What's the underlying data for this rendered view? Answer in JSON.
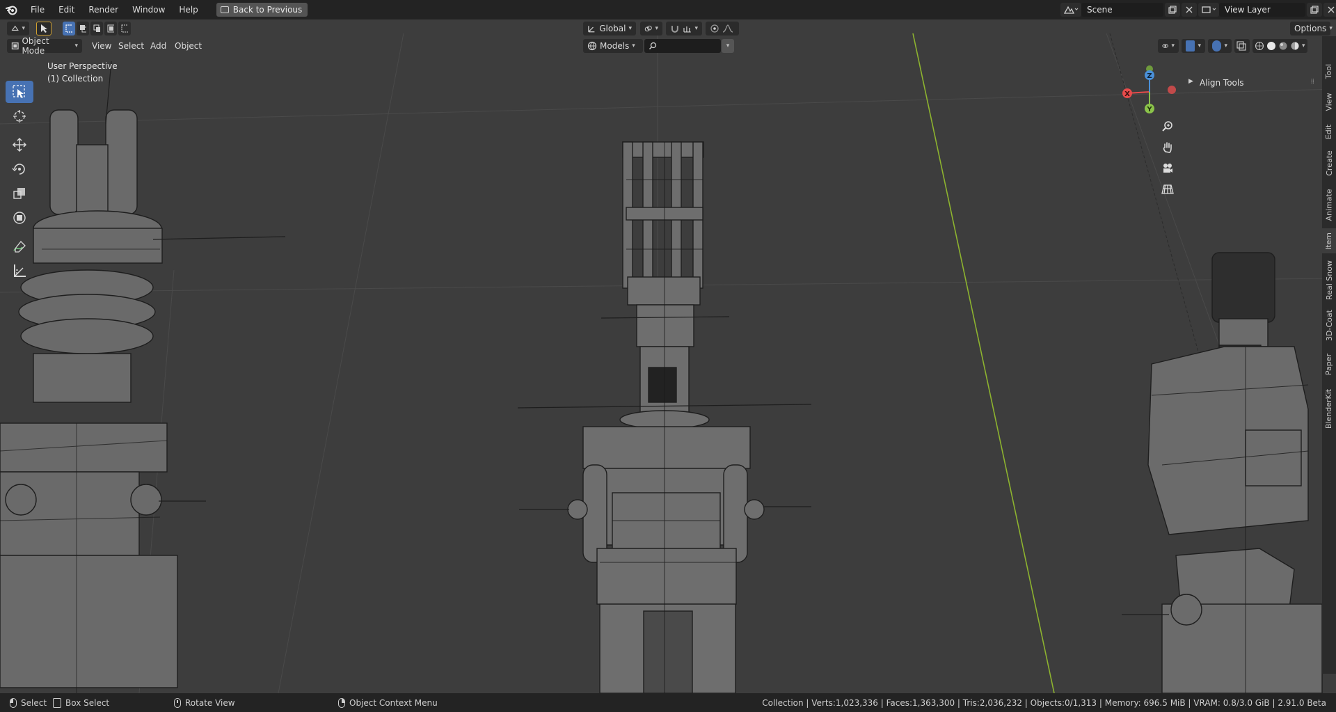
{
  "menubar": {
    "items": [
      "File",
      "Edit",
      "Render",
      "Window",
      "Help"
    ],
    "back_button": "Back to Previous",
    "scene": "Scene",
    "view_layer": "View Layer"
  },
  "header": {
    "transform_orientation": "Global",
    "options": "Options",
    "mode": "Object Mode",
    "menus": [
      "View",
      "Select",
      "Add",
      "Object"
    ],
    "collection_filter": "Models",
    "search_placeholder": ""
  },
  "viewport": {
    "perspective_label": "User Perspective",
    "collection_label": "(1) Collection",
    "gizmo_axes": {
      "x": "X",
      "y": "Y",
      "z": "Z"
    }
  },
  "sidebar": {
    "panel_title": "Align Tools",
    "tabs": [
      "Tool",
      "View",
      "Edit",
      "Create",
      "Animate",
      "Item",
      "Real Snow",
      "3D-Coat",
      "Paper",
      "BlenderKit"
    ],
    "active_tab": "Item"
  },
  "statusbar": {
    "select": "Select",
    "box_select": "Box Select",
    "rotate_view": "Rotate View",
    "context_menu": "Object Context Menu",
    "stats": "Collection | Verts:1,023,336 | Faces:1,363,300 | Tris:2,036,232 | Objects:0/1,313 | Memory: 696.5 MiB | VRAM: 0.8/3.0 GiB | 2.91.0 Beta"
  },
  "colors": {
    "accent": "#4772b3",
    "x_axis": "#e84b4b",
    "y_axis": "#8bc34a",
    "z_axis": "#4a90d9",
    "green_line": "#8db32f"
  }
}
